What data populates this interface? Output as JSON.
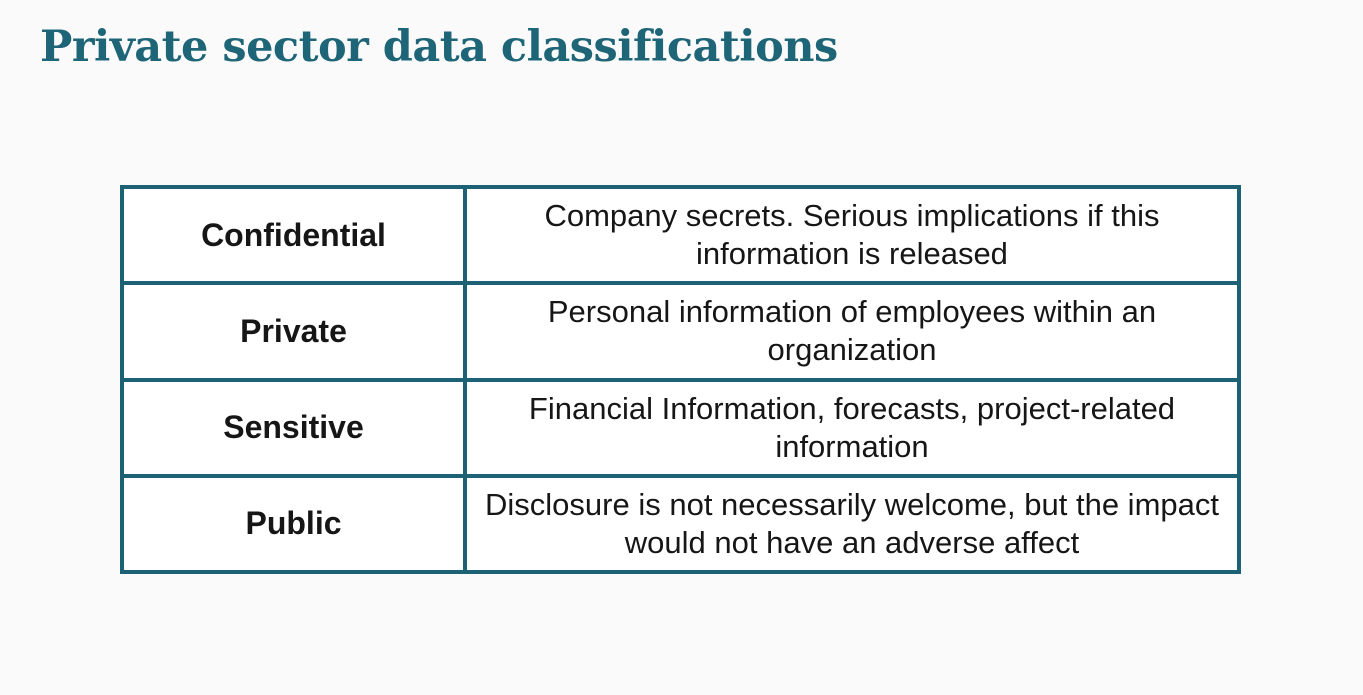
{
  "slide": {
    "title": "Private sector data classifications"
  },
  "table": {
    "rows": [
      {
        "category": "Confidential",
        "description": "Company secrets. Serious implications if this information is released"
      },
      {
        "category": "Private",
        "description": "Personal information of employees within an organization"
      },
      {
        "category": "Sensitive",
        "description": "Financial Information, forecasts, project-related information"
      },
      {
        "category": "Public",
        "description": "Disclosure is not necessarily welcome, but the impact would not have an adverse affect"
      }
    ]
  },
  "colors": {
    "title": "#1e6577",
    "table_border": "#1d6174",
    "text": "#161616",
    "background": "#fafafa"
  }
}
